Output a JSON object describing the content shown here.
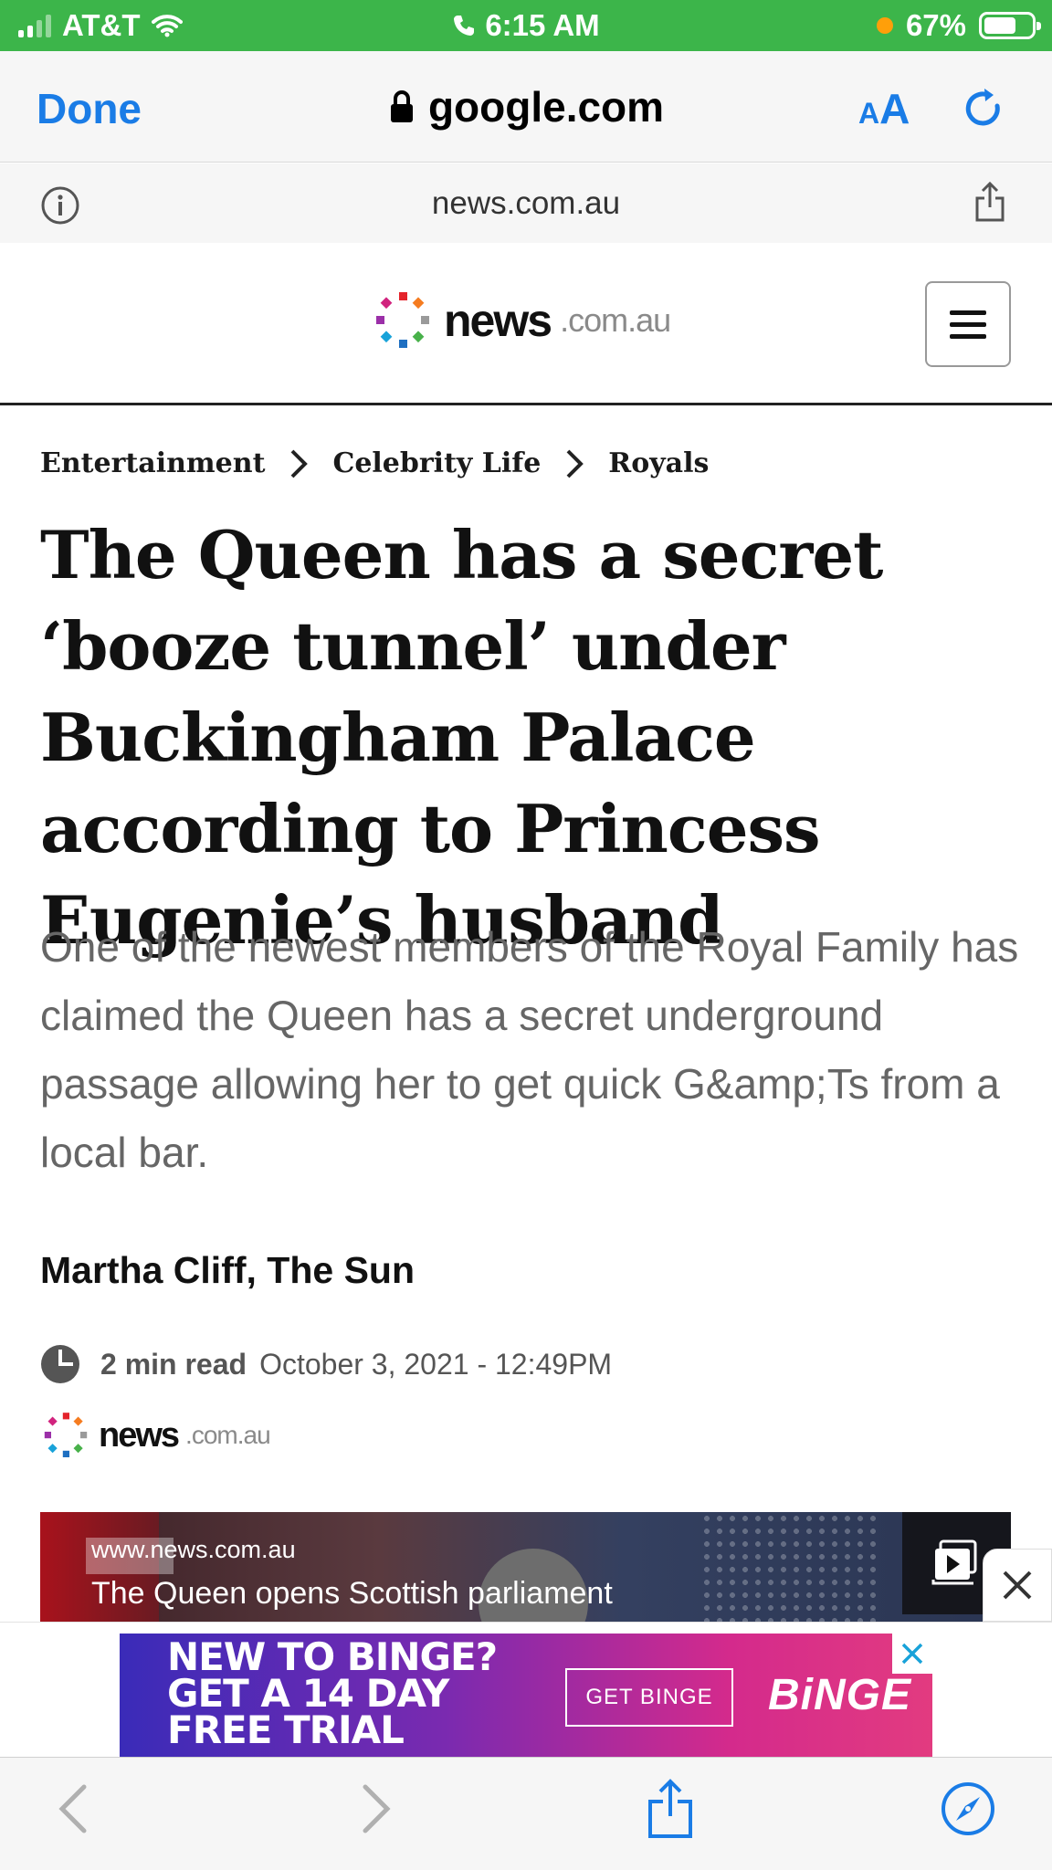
{
  "status_bar": {
    "carrier": "AT&T",
    "time": "6:15 AM",
    "battery_percent": "67%",
    "battery_level": 0.67,
    "bar_color": "#3cb54a"
  },
  "browser": {
    "done_label": "Done",
    "url": "google.com",
    "text_size_small": "A",
    "text_size_large": "A",
    "site_host": "news.com.au",
    "accent_color": "#1a7ce6"
  },
  "site": {
    "logo_word": "news",
    "logo_domain": ".com.au"
  },
  "breadcrumb": [
    {
      "label": "Entertainment"
    },
    {
      "label": "Celebrity Life"
    },
    {
      "label": "Royals"
    }
  ],
  "article": {
    "headline": "The Queen has a secret ‘booze tunnel’ under Buckingham Palace according to Princess Eugenie’s husband",
    "standfirst": "One of the newest members of the Royal Family has claimed the Queen has a secret underground passage allowing her to get quick G&amp;Ts from a local bar.",
    "byline": "Martha Cliff, The Sun",
    "read_time": "2 min read",
    "date": "October 3, 2021 - 12:49PM",
    "source_logo_word": "news",
    "source_logo_domain": ".com.au"
  },
  "video": {
    "source": "www.news.com.au",
    "title": "The Queen opens Scottish parliament"
  },
  "ad": {
    "headline_lines": [
      "NEW TO BINGE?",
      "GET A 14 DAY",
      "FREE TRIAL"
    ],
    "cta": "GET BINGE",
    "brand": "BiNGE"
  },
  "icons": {
    "lock": "lock-icon",
    "reload": "reload-icon",
    "info": "info-icon",
    "share": "share-icon",
    "menu": "hamburger-menu-icon",
    "chevron": "chevron-right-icon",
    "clock": "clock-icon",
    "play": "play-icon",
    "close": "close-icon",
    "back": "back-arrow-icon",
    "forward": "forward-arrow-icon",
    "compass": "compass-icon"
  }
}
